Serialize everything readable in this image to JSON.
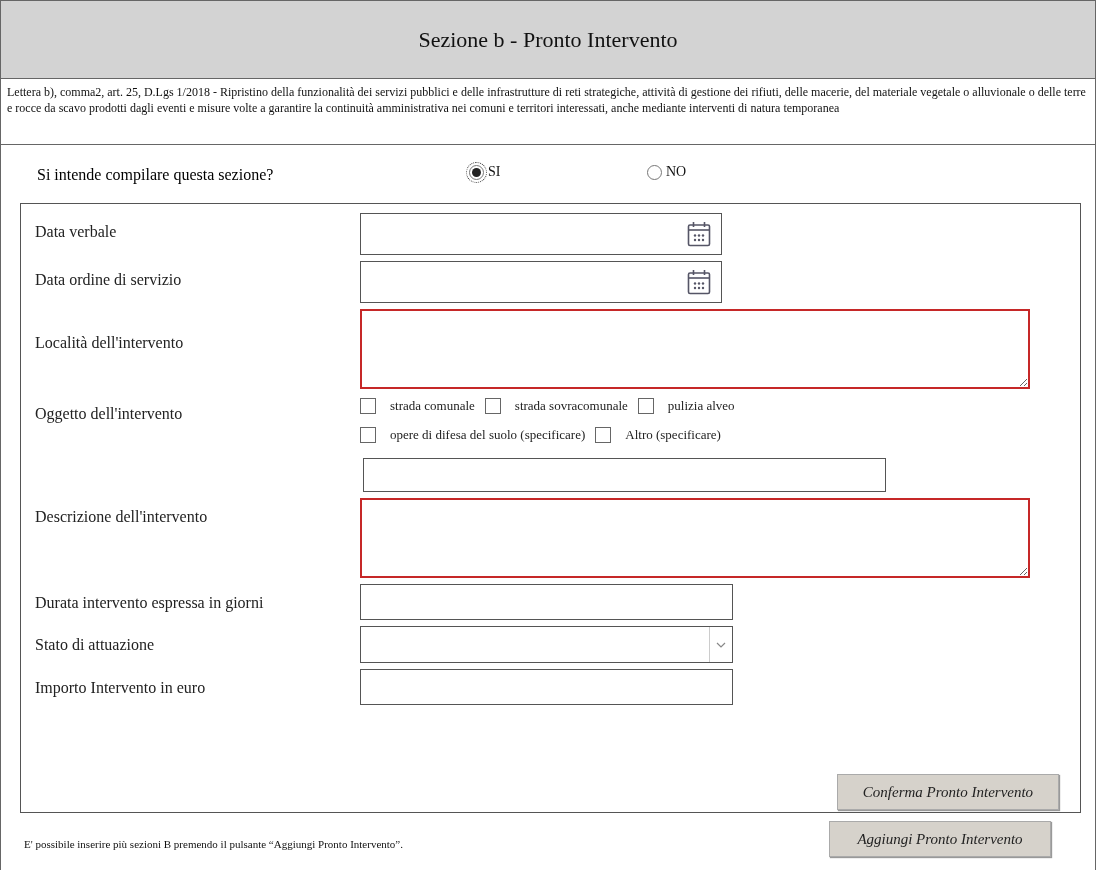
{
  "header": {
    "title": "Sezione b - Pronto Intervento"
  },
  "description": "Lettera b), comma2, art. 25, D.Lgs 1/2018 - Ripristino della funzionalità dei servizi pubblici e delle infrastrutture di reti strategiche, attività di gestione dei rifiuti, delle macerie, del materiale vegetale o alluvionale o delle terre e rocce da scavo prodotti dagli eventi e misure volte a garantire la continuità amministrativa nei comuni e territori interessati, anche mediante interventi di natura temporanea",
  "question": {
    "label": "Si intende compilare questa sezione?",
    "options": [
      {
        "label": "SI",
        "selected": true
      },
      {
        "label": "NO",
        "selected": false
      }
    ]
  },
  "fields": [
    {
      "kind": "date",
      "label": "Data verbale"
    },
    {
      "kind": "date",
      "label": "Data ordine di servizio"
    },
    {
      "kind": "area",
      "label": "Località dell'intervento",
      "invalid": true
    },
    {
      "kind": "checks",
      "label": "Oggetto dell'intervento",
      "rows": [
        {
          "options": [
            {
              "label": "strada comunale",
              "checked": false
            },
            {
              "label": "strada sovracomunale",
              "checked": false
            },
            {
              "label": "pulizia alveo",
              "checked": false
            }
          ]
        },
        {
          "options": [
            {
              "label": "opere di difesa del suolo (specificare)",
              "checked": false
            },
            {
              "label": "Altro (specificare)",
              "checked": false
            }
          ]
        }
      ]
    },
    {
      "kind": "area",
      "label": "Descrizione dell'intervento",
      "invalid": true
    },
    {
      "kind": "text",
      "label": "Durata intervento espressa in giorni"
    },
    {
      "kind": "select",
      "label": "Stato di attuazione"
    },
    {
      "kind": "text",
      "label": "Importo Intervento in euro"
    }
  ],
  "confirm_button": "Conferma Pronto Intervento",
  "footer": {
    "note": "E' possibile inserire più sezioni B premendo il pulsante “Aggiungi Pronto Intervento”.",
    "button": "Aggiungi Pronto Intervento"
  }
}
